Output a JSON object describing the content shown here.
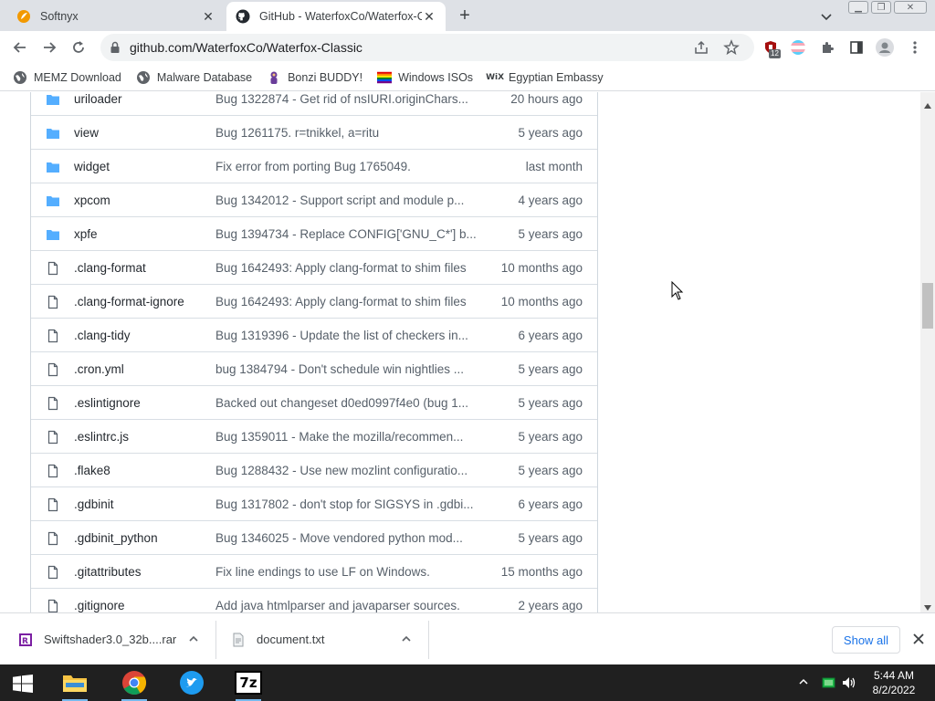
{
  "browser": {
    "tabs": [
      {
        "title": "Softnyx",
        "active": false,
        "icon": "softnyx-icon"
      },
      {
        "title": "GitHub - WaterfoxCo/Waterfox-C",
        "active": true,
        "icon": "github-icon"
      }
    ],
    "url": "github.com/WaterfoxCo/Waterfox-Classic",
    "extension_badge": "12"
  },
  "bookmarks": [
    {
      "label": "MEMZ Download",
      "icon": "globe-icon"
    },
    {
      "label": "Malware Database",
      "icon": "globe-icon"
    },
    {
      "label": "Bonzi BUDDY!",
      "icon": "bonzi-icon"
    },
    {
      "label": "Windows ISOs",
      "icon": "rainbow-flag-icon"
    },
    {
      "label": "Egyptian Embassy",
      "icon": "wix-icon"
    }
  ],
  "files": [
    {
      "name": "uriloader",
      "type": "dir",
      "message": "Bug 1322874 - Get rid of nsIURI.originChars...",
      "age": "20 hours ago"
    },
    {
      "name": "view",
      "type": "dir",
      "message": "Bug 1261175. r=tnikkel, a=ritu",
      "age": "5 years ago"
    },
    {
      "name": "widget",
      "type": "dir",
      "message": "Fix error from porting Bug 1765049.",
      "age": "last month"
    },
    {
      "name": "xpcom",
      "type": "dir",
      "message": "Bug 1342012 - Support script and module p...",
      "age": "4 years ago"
    },
    {
      "name": "xpfe",
      "type": "dir",
      "message": "Bug 1394734 - Replace CONFIG['GNU_C*'] b...",
      "age": "5 years ago"
    },
    {
      "name": ".clang-format",
      "type": "file",
      "message": "Bug 1642493: Apply clang-format to shim files",
      "age": "10 months ago"
    },
    {
      "name": ".clang-format-ignore",
      "type": "file",
      "message": "Bug 1642493: Apply clang-format to shim files",
      "age": "10 months ago"
    },
    {
      "name": ".clang-tidy",
      "type": "file",
      "message": "Bug 1319396 - Update the list of checkers in...",
      "age": "6 years ago"
    },
    {
      "name": ".cron.yml",
      "type": "file",
      "message": "bug 1384794 - Don't schedule win nightlies ...",
      "age": "5 years ago"
    },
    {
      "name": ".eslintignore",
      "type": "file",
      "message": "Backed out changeset d0ed0997f4e0 (bug 1...",
      "age": "5 years ago"
    },
    {
      "name": ".eslintrc.js",
      "type": "file",
      "message": "Bug 1359011 - Make the mozilla/recommen...",
      "age": "5 years ago"
    },
    {
      "name": ".flake8",
      "type": "file",
      "message": "Bug 1288432 - Use new mozlint configuratio...",
      "age": "5 years ago"
    },
    {
      "name": ".gdbinit",
      "type": "file",
      "message": "Bug 1317802 - don't stop for SIGSYS in .gdbi...",
      "age": "6 years ago"
    },
    {
      "name": ".gdbinit_python",
      "type": "file",
      "message": "Bug 1346025 - Move vendored python mod...",
      "age": "5 years ago"
    },
    {
      "name": ".gitattributes",
      "type": "file",
      "message": "Fix line endings to use LF on Windows.",
      "age": "15 months ago"
    },
    {
      "name": ".gitignore",
      "type": "file",
      "message": "Add java htmlparser and javaparser sources.",
      "age": "2 years ago"
    }
  ],
  "downloads": {
    "items": [
      {
        "name": "Swiftshader3.0_32b....rar",
        "icon": "rar-archive-icon"
      },
      {
        "name": "document.txt",
        "icon": "text-file-icon"
      }
    ],
    "show_all_label": "Show all"
  },
  "taskbar": {
    "time": "5:44 AM",
    "date": "8/2/2022",
    "apps": [
      "file-explorer-icon",
      "chrome-icon",
      "twitter-icon",
      "7zip-icon"
    ],
    "seven_zip_label": "7z"
  },
  "colors": {
    "folder": "#54aeff",
    "github_text": "#24292f",
    "github_muted": "#57606a",
    "link_blue": "#1a73e8",
    "taskbar_bg": "#202020"
  }
}
